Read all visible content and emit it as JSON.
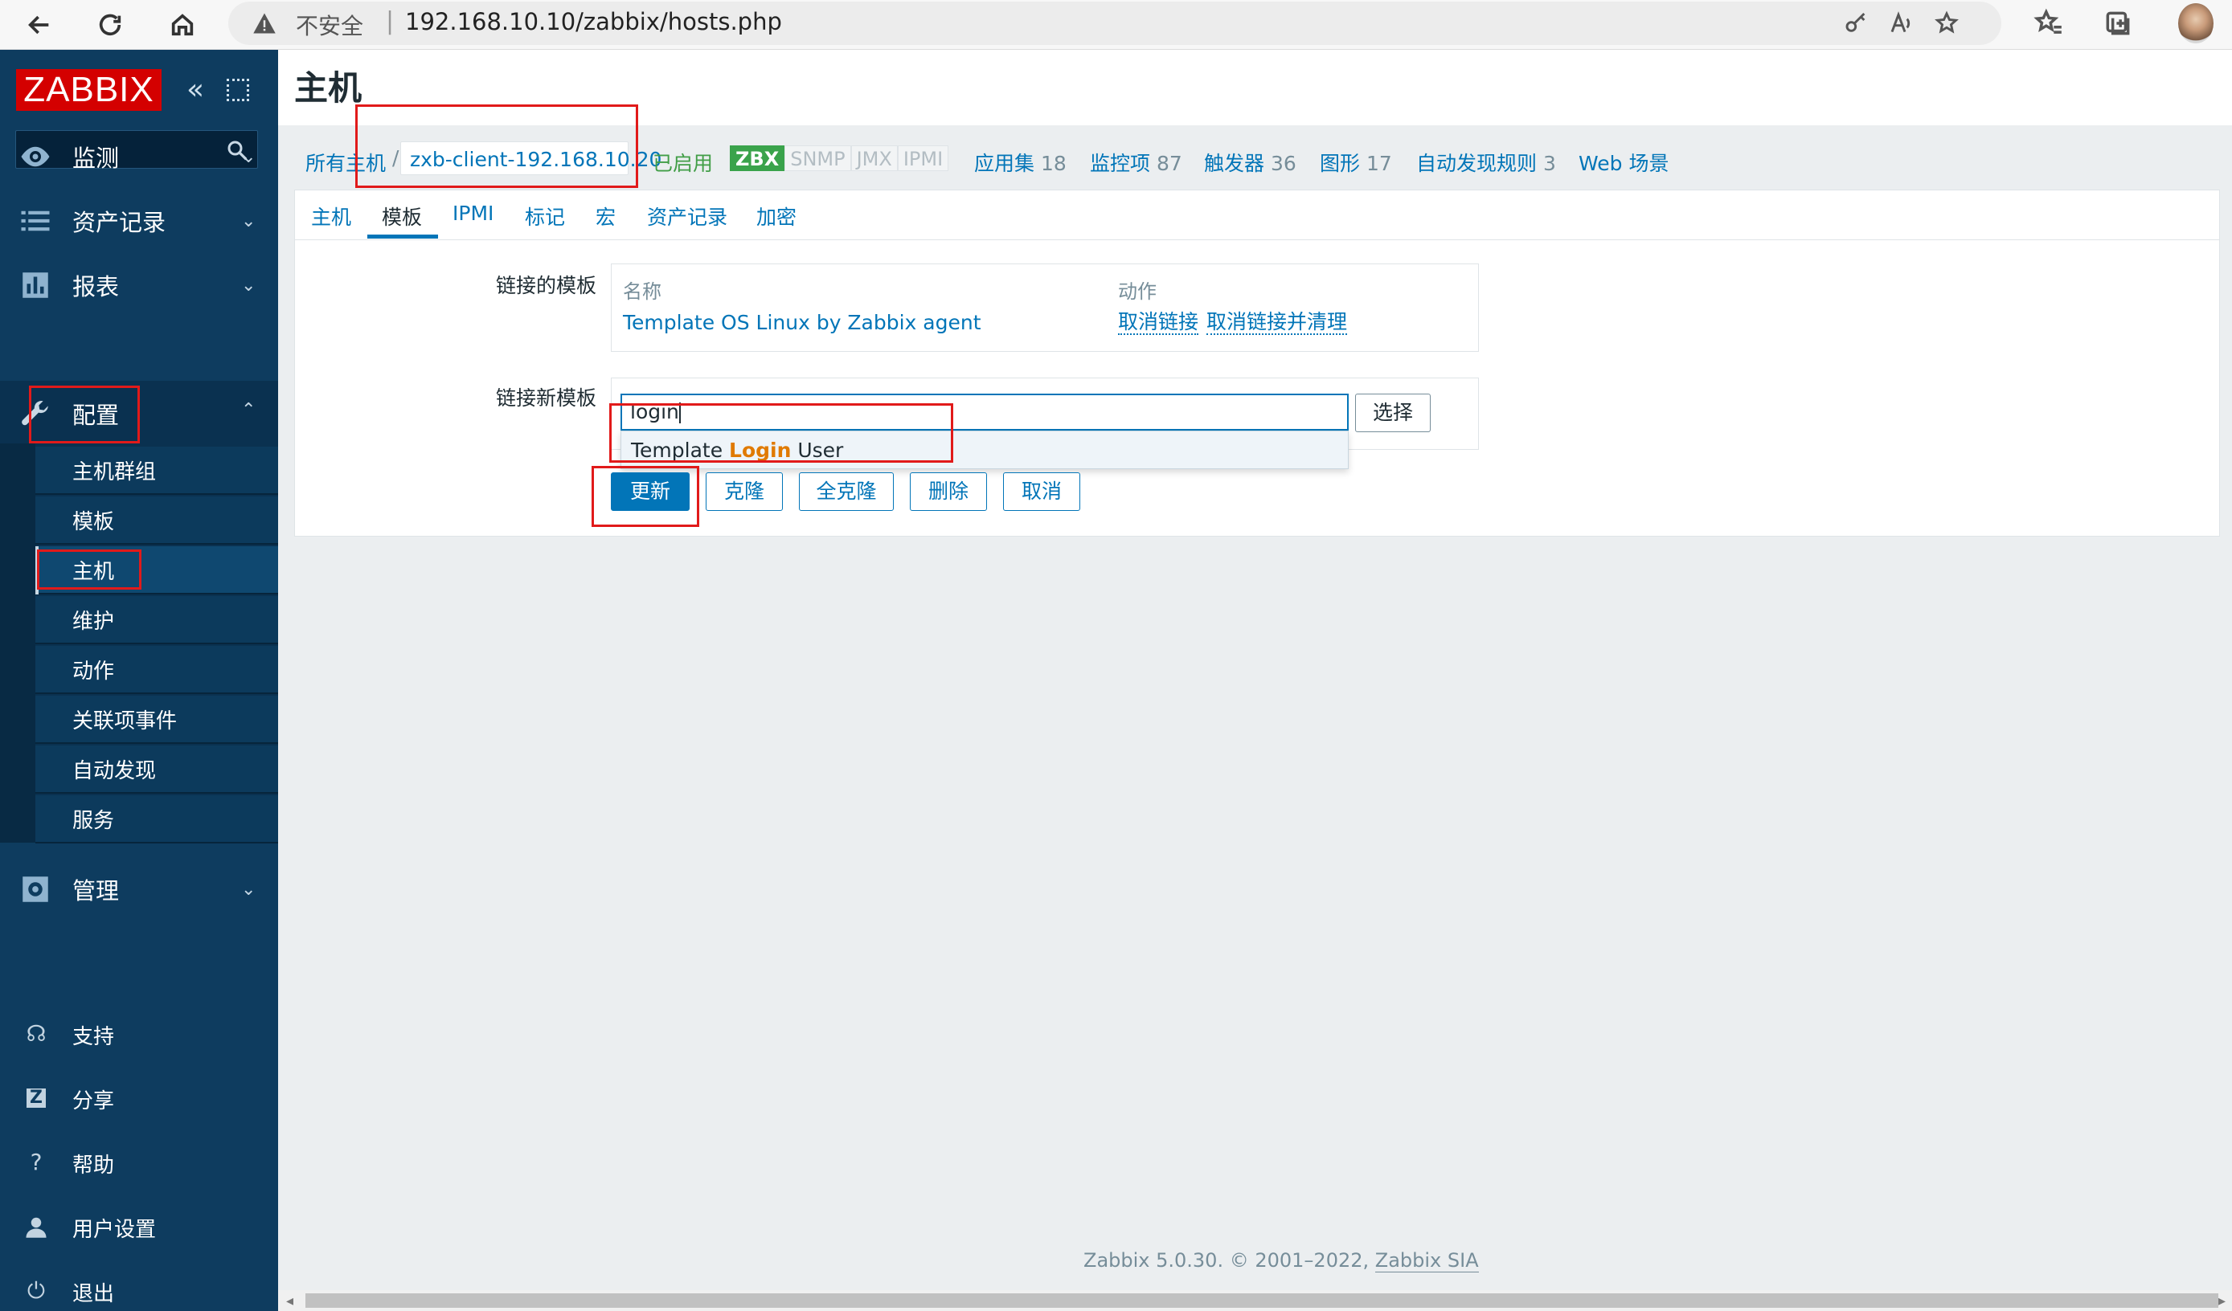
{
  "browser": {
    "insecure_label": "不安全",
    "url": "192.168.10.10/zabbix/hosts.php"
  },
  "sidebar": {
    "logo": "ZABBIX",
    "menu": [
      {
        "label": "监测",
        "icon": "eye-icon"
      },
      {
        "label": "资产记录",
        "icon": "list-icon"
      },
      {
        "label": "报表",
        "icon": "bar-chart-icon"
      },
      {
        "label": "配置",
        "icon": "wrench-icon"
      },
      {
        "label": "管理",
        "icon": "gear-icon"
      }
    ],
    "config_sub": [
      "主机群组",
      "模板",
      "主机",
      "维护",
      "动作",
      "关联项事件",
      "自动发现",
      "服务"
    ],
    "footer": [
      {
        "label": "支持",
        "icon": "headset-icon"
      },
      {
        "label": "分享",
        "icon": "share-icon"
      },
      {
        "label": "帮助",
        "icon": "help-icon"
      },
      {
        "label": "用户设置",
        "icon": "user-icon"
      },
      {
        "label": "退出",
        "icon": "power-icon"
      }
    ]
  },
  "page": {
    "title": "主机"
  },
  "breadcrumb": {
    "all_hosts": "所有主机",
    "separator": "/",
    "host": "zxb-client-192.168.10.20",
    "status": "已启用",
    "badges": [
      "ZBX",
      "SNMP",
      "JMX",
      "IPMI"
    ],
    "links": [
      {
        "label": "应用集",
        "count": "18"
      },
      {
        "label": "监控项",
        "count": "87"
      },
      {
        "label": "触发器",
        "count": "36"
      },
      {
        "label": "图形",
        "count": "17"
      },
      {
        "label": "自动发现规则",
        "count": "3"
      },
      {
        "label": "Web 场景",
        "count": ""
      }
    ]
  },
  "tabs": [
    "主机",
    "模板",
    "IPMI",
    "标记",
    "宏",
    "资产记录",
    "加密"
  ],
  "form": {
    "linked_label": "链接的模板",
    "col_name": "名称",
    "col_action": "动作",
    "linked_template": "Template OS Linux by Zabbix agent",
    "unlink": "取消链接",
    "unlink_clear": "取消链接并清理",
    "new_label": "链接新模板",
    "input_value": "login",
    "select_button": "选择",
    "suggest_prefix": "Template ",
    "suggest_match": "Login",
    "suggest_suffix": " User"
  },
  "buttons": {
    "update": "更新",
    "clone": "克隆",
    "full_clone": "全克隆",
    "delete": "删除",
    "cancel": "取消"
  },
  "footer": {
    "text": "Zabbix 5.0.30. © 2001–2022, ",
    "company": "Zabbix SIA"
  }
}
